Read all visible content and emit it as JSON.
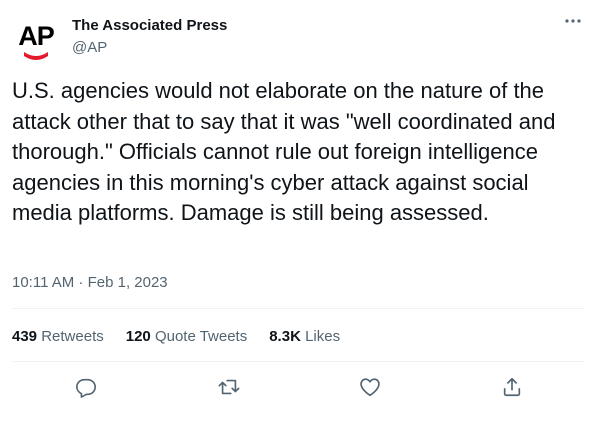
{
  "author": {
    "avatar_text": "AP",
    "name": "The Associated Press",
    "handle": "@AP"
  },
  "tweet": {
    "text": "U.S. agencies would not elaborate on the nature of the attack other that to say that it was \"well coordinated and thorough.\" Officials cannot rule out foreign intelligence agencies in this morning's cyber attack against social media platforms. Damage is still being assessed.",
    "timestamp": "10:11 AM · Feb 1, 2023"
  },
  "stats": {
    "retweets_count": "439",
    "retweets_label": "Retweets",
    "quotes_count": "120",
    "quotes_label": "Quote Tweets",
    "likes_count": "8.3K",
    "likes_label": "Likes"
  },
  "icons": {
    "more": "more-horizontal-icon",
    "reply": "reply-icon",
    "retweet": "retweet-icon",
    "like": "heart-icon",
    "share": "share-icon"
  },
  "colors": {
    "text_primary": "#0f1419",
    "text_secondary": "#536471",
    "divider": "#eff3f4",
    "ap_red": "#e31a2d"
  }
}
